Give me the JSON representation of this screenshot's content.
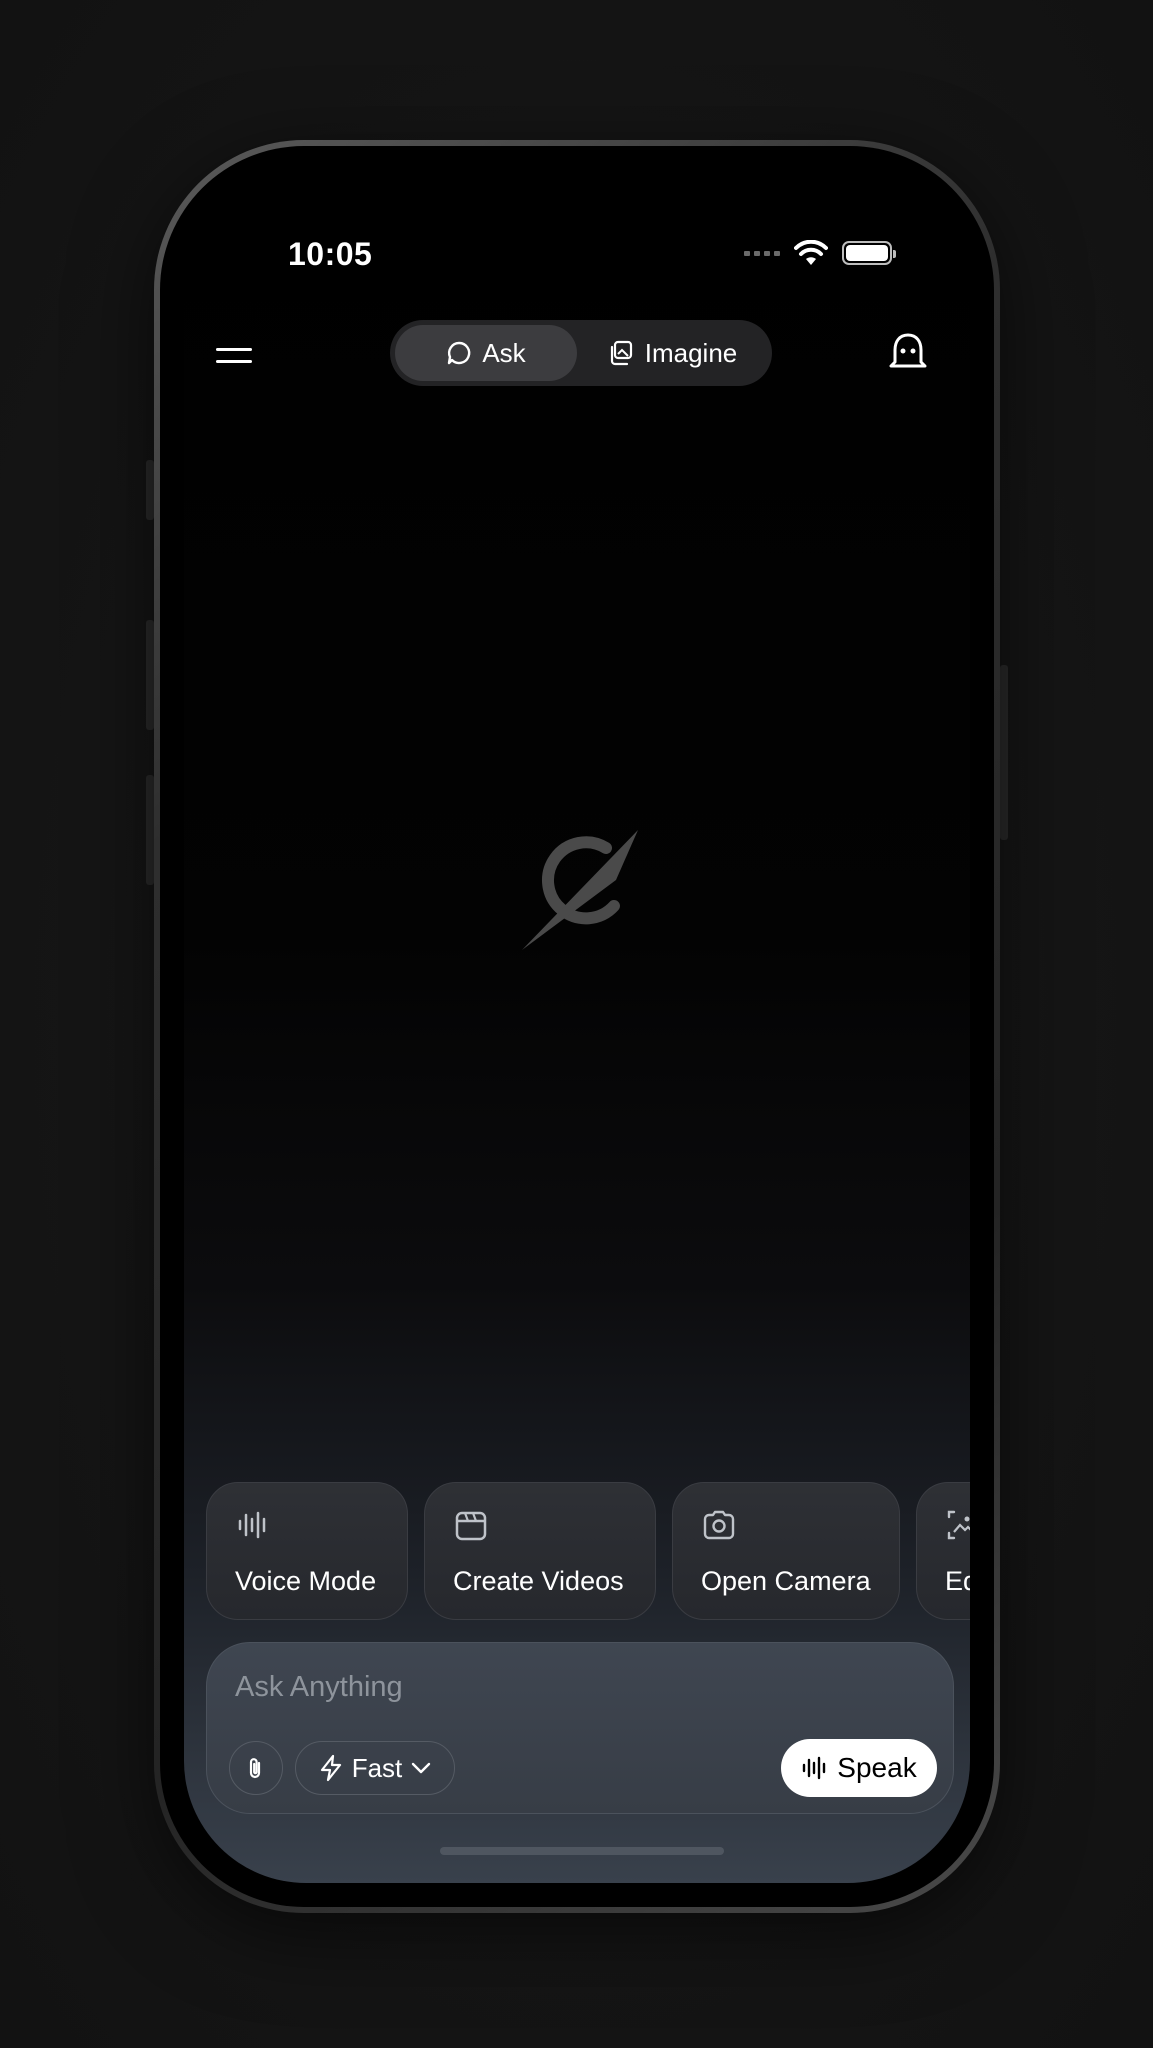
{
  "status_bar": {
    "time": "10:05"
  },
  "header": {
    "tabs": [
      {
        "label": "Ask",
        "active": true,
        "icon": "chat-bubble-icon"
      },
      {
        "label": "Imagine",
        "active": false,
        "icon": "images-icon"
      }
    ],
    "menu_icon": "hamburger-menu-icon",
    "ghost_icon": "ghost-icon"
  },
  "center": {
    "logo_icon": "grok-logo-icon"
  },
  "quick_actions": [
    {
      "label": "Voice Mode",
      "icon": "waveform-icon"
    },
    {
      "label": "Create Videos",
      "icon": "clapperboard-icon"
    },
    {
      "label": "Open Camera",
      "icon": "camera-icon"
    },
    {
      "label": "Ed",
      "icon": "edit-image-icon"
    }
  ],
  "composer": {
    "placeholder": "Ask Anything",
    "model_label": "Fast",
    "speak_label": "Speak"
  },
  "colors": {
    "background": "#161616",
    "screen_top": "#000000",
    "screen_bottom": "#39414c",
    "accent_white": "#ffffff"
  }
}
